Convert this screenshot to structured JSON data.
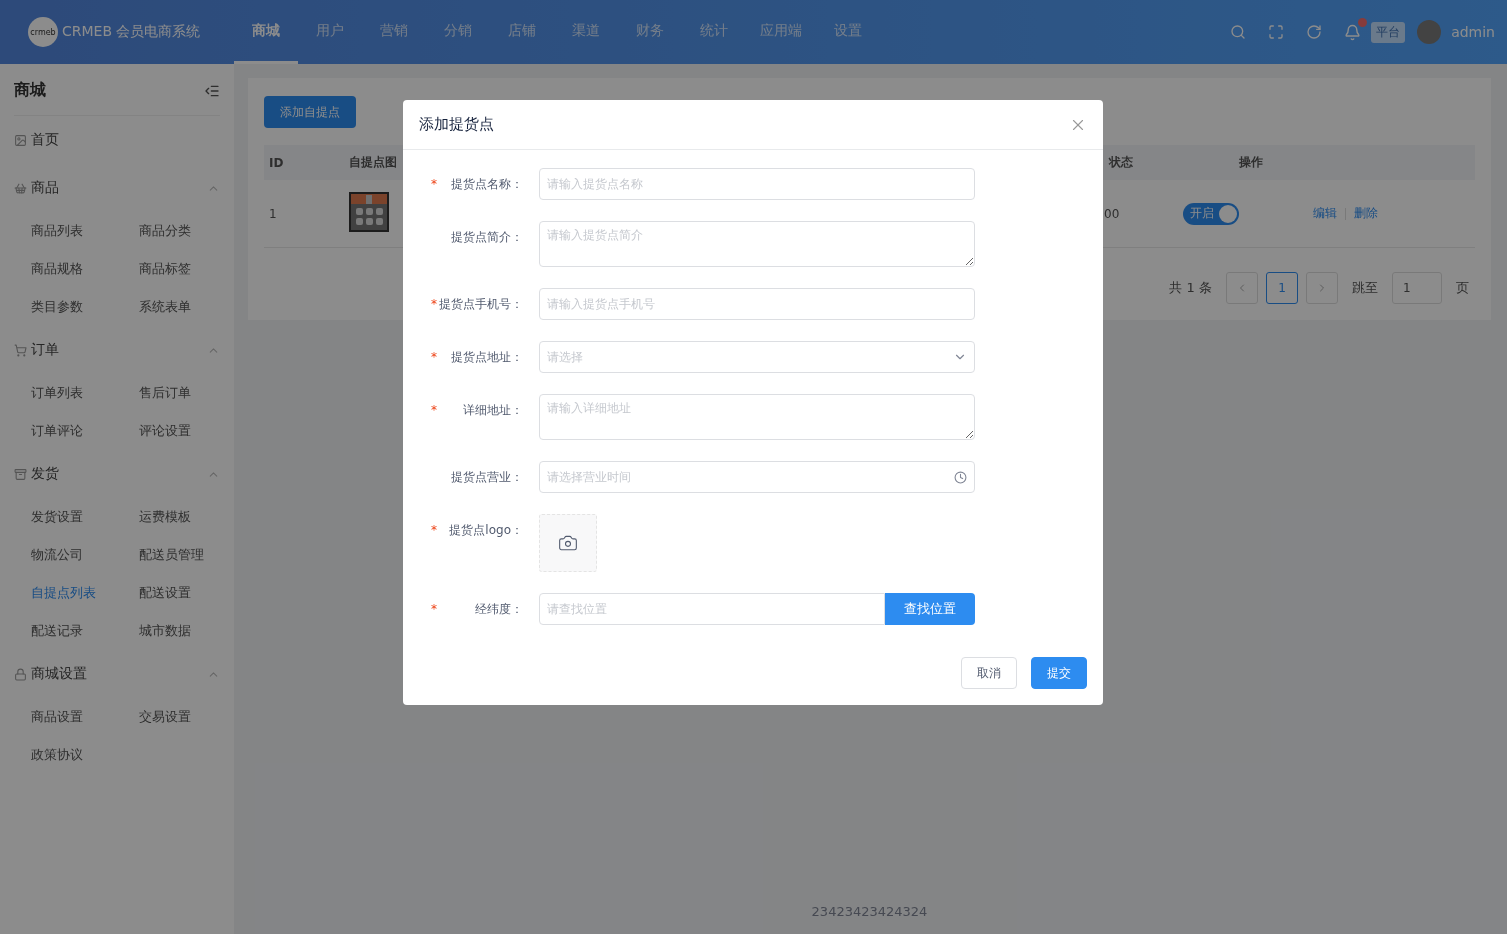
{
  "header": {
    "logo_badge": "crmeb",
    "logo_text": "CRMEB 会员电商系统",
    "nav": [
      {
        "label": "商城",
        "selected": true
      },
      {
        "label": "用户",
        "selected": false
      },
      {
        "label": "营销",
        "selected": false
      },
      {
        "label": "分销",
        "selected": false
      },
      {
        "label": "店铺",
        "selected": false
      },
      {
        "label": "渠道",
        "selected": false
      },
      {
        "label": "财务",
        "selected": false
      },
      {
        "label": "统计",
        "selected": false
      },
      {
        "label": "应用端",
        "selected": false
      },
      {
        "label": "设置",
        "selected": false
      }
    ],
    "notification_unread": true,
    "platform_badge": "平台",
    "user": "admin"
  },
  "sidebar": {
    "title": "商城",
    "home": "首页",
    "groups": [
      {
        "label": "商品",
        "expanded": true,
        "children": [
          {
            "label": "商品列表",
            "selected": false
          },
          {
            "label": "商品分类",
            "selected": false
          },
          {
            "label": "商品规格",
            "selected": false
          },
          {
            "label": "商品标签",
            "selected": false
          },
          {
            "label": "类目参数",
            "selected": false
          },
          {
            "label": "系统表单",
            "selected": false
          }
        ]
      },
      {
        "label": "订单",
        "expanded": true,
        "children": [
          {
            "label": "订单列表",
            "selected": false
          },
          {
            "label": "售后订单",
            "selected": false
          },
          {
            "label": "订单评论",
            "selected": false
          },
          {
            "label": "评论设置",
            "selected": false
          }
        ]
      },
      {
        "label": "发货",
        "expanded": true,
        "children": [
          {
            "label": "发货设置",
            "selected": false
          },
          {
            "label": "运费模板",
            "selected": false
          },
          {
            "label": "物流公司",
            "selected": false
          },
          {
            "label": "配送员管理",
            "selected": false
          },
          {
            "label": "自提点列表",
            "selected": true
          },
          {
            "label": "配送设置",
            "selected": false
          },
          {
            "label": "配送记录",
            "selected": false
          },
          {
            "label": "城市数据",
            "selected": false
          }
        ]
      },
      {
        "label": "商城设置",
        "expanded": true,
        "children": [
          {
            "label": "商品设置",
            "selected": false
          },
          {
            "label": "交易设置",
            "selected": false
          },
          {
            "label": "政策协议",
            "selected": false
          }
        ]
      }
    ]
  },
  "content": {
    "add_button": "添加自提点",
    "table": {
      "columns": [
        "ID",
        "自提点图",
        "状态",
        "操作"
      ],
      "rows": [
        {
          "id": "1",
          "image": {
            "kind": "picture"
          },
          "column_3": "00",
          "status": {
            "label": "开启",
            "on": true
          },
          "actions": [
            "编辑",
            "删除"
          ]
        }
      ]
    },
    "pagination": {
      "total": "共 1 条",
      "pages": [
        {
          "label": "1",
          "selected": true
        }
      ],
      "jump_label": "跳至",
      "jump_value": "1",
      "page_unit": "页"
    },
    "footer": "23423423424324"
  },
  "dialog": {
    "title": "添加提货点",
    "required_mark": "*",
    "fields": [
      {
        "kind": "input",
        "label": "提货点名称：",
        "required": true,
        "placeholder": "请输入提货点名称"
      },
      {
        "kind": "textarea",
        "label": "提货点简介：",
        "required": false,
        "placeholder": "请输入提货点简介"
      },
      {
        "kind": "input",
        "label": "提货点手机号：",
        "required": true,
        "placeholder": "请输入提货点手机号"
      },
      {
        "kind": "select",
        "label": "提货点地址：",
        "required": true,
        "placeholder": "请选择"
      },
      {
        "kind": "textarea",
        "label": "详细地址：",
        "required": true,
        "placeholder": "请输入详细地址"
      },
      {
        "kind": "time",
        "label": "提货点营业：",
        "required": false,
        "placeholder": "请选择营业时间"
      },
      {
        "kind": "upload",
        "label": "提货点logo：",
        "required": true
      },
      {
        "kind": "search",
        "label": "经纬度：",
        "required": true,
        "placeholder": "请查找位置",
        "button": "查找位置"
      }
    ],
    "buttons": [
      {
        "label": "取消",
        "primary": false
      },
      {
        "label": "提交",
        "primary": true
      }
    ]
  }
}
